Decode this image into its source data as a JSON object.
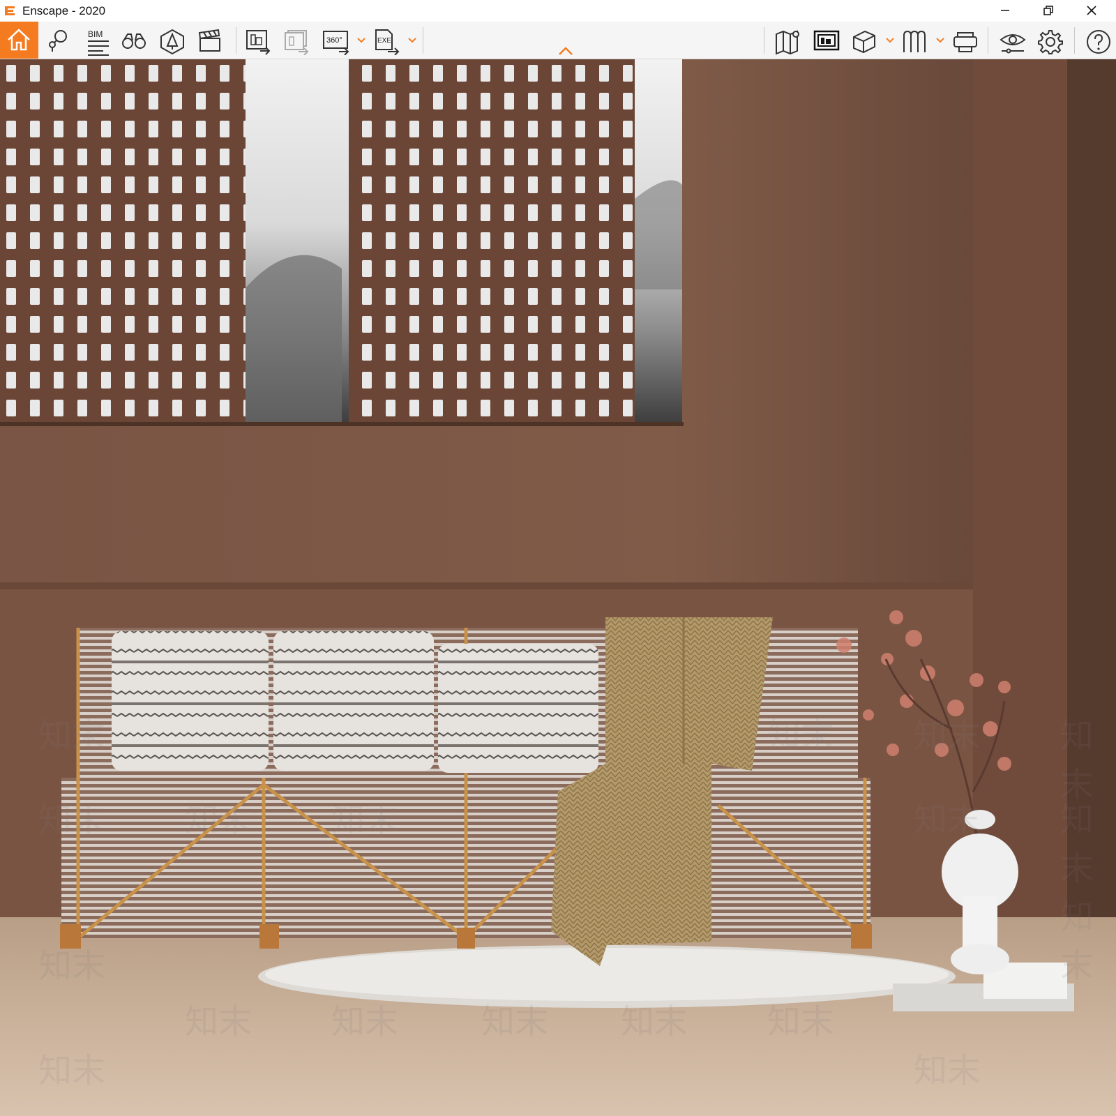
{
  "window": {
    "title": "Enscape - 2020",
    "accent_color": "#f47b20"
  },
  "window_controls": [
    "minimize-icon",
    "restore-icon",
    "close-icon"
  ],
  "toolbar": {
    "left_group": [
      {
        "name": "home-icon",
        "active": true
      },
      {
        "name": "view-management-icon"
      },
      {
        "name": "bim-icon",
        "label": "BIM"
      },
      {
        "name": "binoculars-icon"
      },
      {
        "name": "asset-library-icon"
      },
      {
        "name": "clapperboard-icon"
      },
      {
        "name": "render-image-icon"
      },
      {
        "name": "batch-render-icon"
      },
      {
        "name": "export-360-icon",
        "label": "360°"
      },
      {
        "name": "export-exe-icon",
        "label": "EXE"
      }
    ],
    "right_group": [
      {
        "name": "map-icon"
      },
      {
        "name": "render-view-icon"
      },
      {
        "name": "cube-icon"
      },
      {
        "name": "bookmark-views-icon"
      },
      {
        "name": "vr-headset-icon"
      },
      {
        "name": "eye-icon"
      },
      {
        "name": "settings-gear-icon"
      },
      {
        "name": "help-icon"
      }
    ]
  },
  "viewport": {
    "scene": "Interior render: slatted sofa with cushions and knit throw, lattice screens in front of misty landscape, brown wall, round rug, white vase with blossoms",
    "watermark_text": "知末",
    "wall_color": "#7d5a47",
    "floor_color": "#cdb59f"
  }
}
